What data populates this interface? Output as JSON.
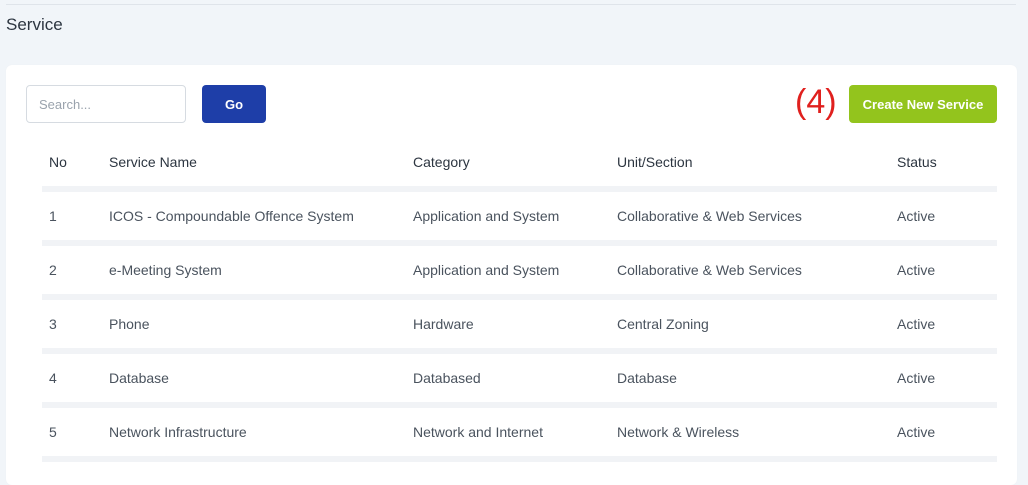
{
  "page": {
    "title": "Service"
  },
  "toolbar": {
    "search_placeholder": "Search...",
    "search_value": "",
    "go_label": "Go",
    "annotation": "(4)",
    "create_label": "Create New Service"
  },
  "table": {
    "headers": {
      "no": "No",
      "name": "Service Name",
      "category": "Category",
      "unit": "Unit/Section",
      "status": "Status"
    },
    "rows": [
      {
        "no": "1",
        "name": "ICOS - Compoundable Offence System",
        "category": "Application and System",
        "unit": "Collaborative & Web Services",
        "status": "Active"
      },
      {
        "no": "2",
        "name": "e-Meeting System",
        "category": "Application and System",
        "unit": "Collaborative & Web Services",
        "status": "Active"
      },
      {
        "no": "3",
        "name": "Phone",
        "category": "Hardware",
        "unit": "Central Zoning",
        "status": "Active"
      },
      {
        "no": "4",
        "name": "Database",
        "category": "Databased",
        "unit": "Database",
        "status": "Active"
      },
      {
        "no": "5",
        "name": "Network Infrastructure",
        "category": "Network and Internet",
        "unit": "Network & Wireless",
        "status": "Active"
      }
    ]
  },
  "colors": {
    "go": "#1e3ea8",
    "create": "#93c41d",
    "active": "#8fc21e",
    "annotation": "#e0201e"
  }
}
